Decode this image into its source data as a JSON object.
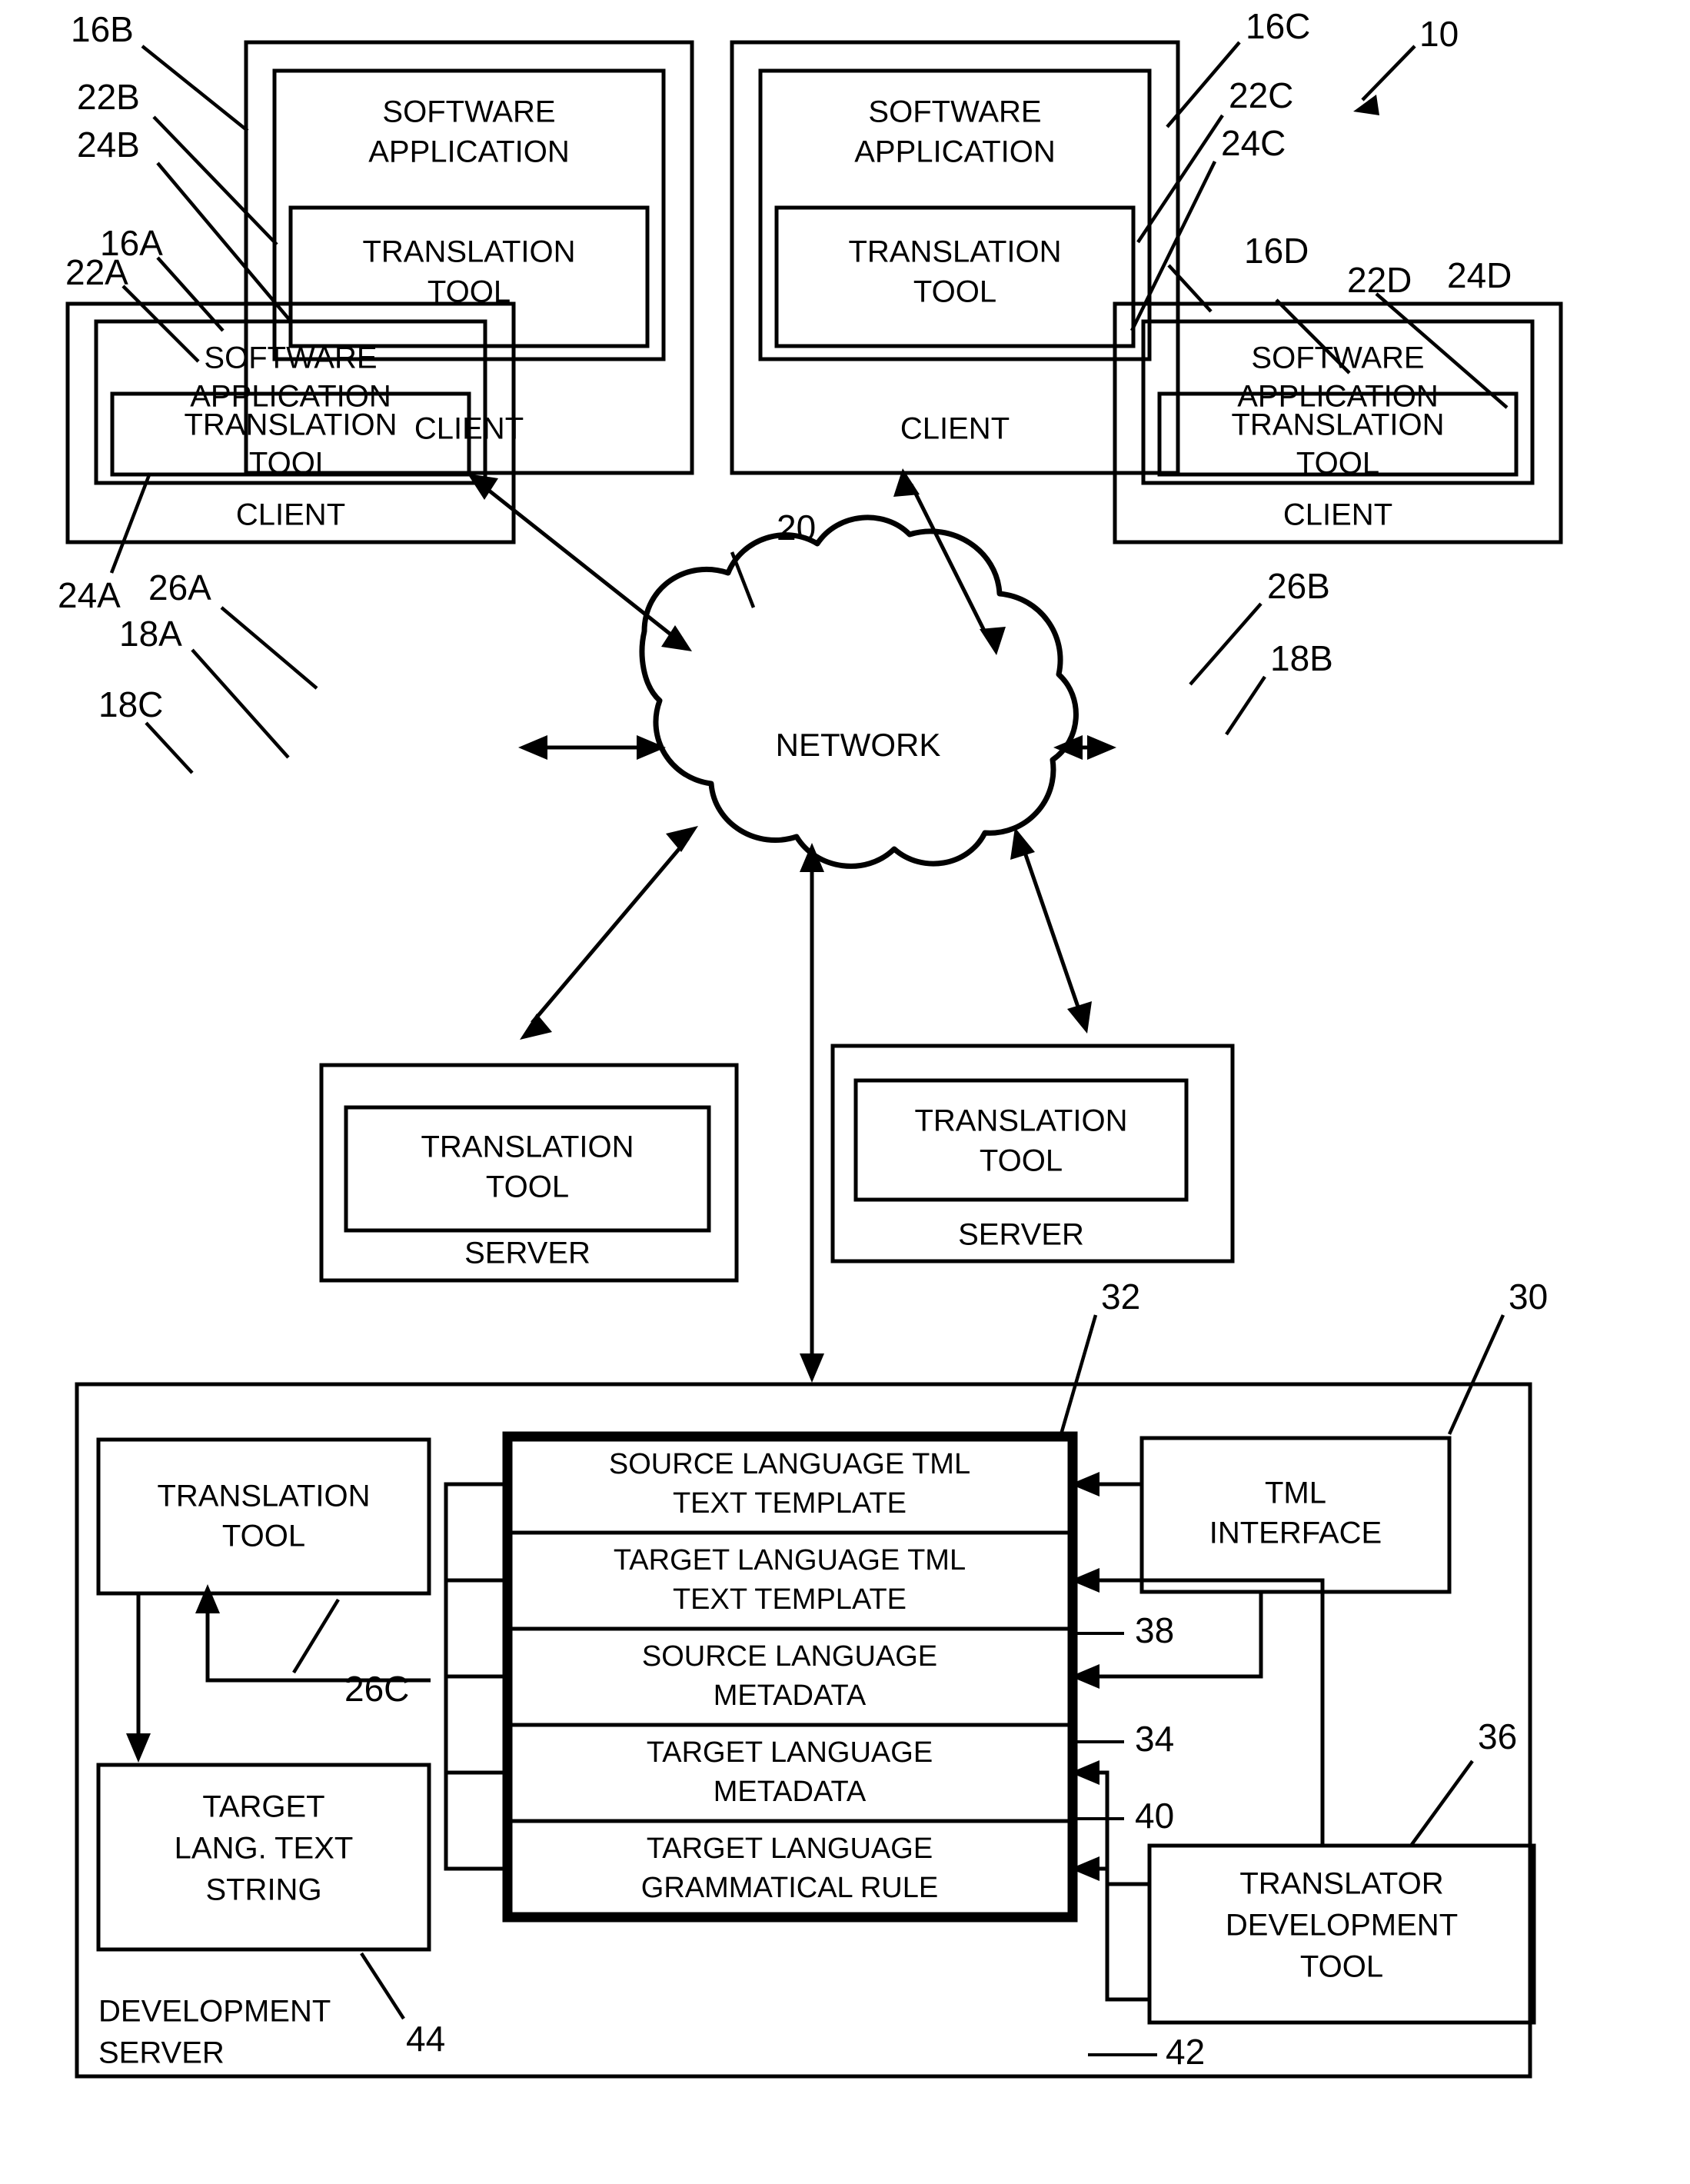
{
  "figure": {
    "system_ref": "10",
    "network_label": "NETWORK",
    "network_ref": "20"
  },
  "clients": [
    {
      "id": "client-a",
      "client_label": "CLIENT",
      "app_label_line1": "SOFTWARE",
      "app_label_line2": "APPLICATION",
      "tool_label_line1": "TRANSLATION",
      "tool_label_line2": "TOOL",
      "ref_client": "16A",
      "ref_app": "22A",
      "ref_tool": "24A"
    },
    {
      "id": "client-b",
      "client_label": "CLIENT",
      "app_label_line1": "SOFTWARE",
      "app_label_line2": "APPLICATION",
      "tool_label_line1": "TRANSLATION",
      "tool_label_line2": "TOOL",
      "ref_client": "16B",
      "ref_app": "22B",
      "ref_tool": "24B"
    },
    {
      "id": "client-c",
      "client_label": "CLIENT",
      "app_label_line1": "SOFTWARE",
      "app_label_line2": "APPLICATION",
      "tool_label_line1": "TRANSLATION",
      "tool_label_line2": "TOOL",
      "ref_client": "16C",
      "ref_app": "22C",
      "ref_tool": "24C"
    },
    {
      "id": "client-d",
      "client_label": "CLIENT",
      "app_label_line1": "SOFTWARE",
      "app_label_line2": "APPLICATION",
      "tool_label_line1": "TRANSLATION",
      "tool_label_line2": "TOOL",
      "ref_client": "16D",
      "ref_app": "22D",
      "ref_tool": "24D"
    }
  ],
  "servers": [
    {
      "id": "server-a",
      "server_label": "SERVER",
      "tool_label_line1": "TRANSLATION",
      "tool_label_line2": "TOOL",
      "ref_server": "18A",
      "ref_tool": "26A"
    },
    {
      "id": "server-b",
      "server_label": "SERVER",
      "tool_label_line1": "TRANSLATION",
      "tool_label_line2": "TOOL",
      "ref_server": "18B",
      "ref_tool": "26B"
    }
  ],
  "development_server": {
    "label_line1": "DEVELOPMENT",
    "label_line2": "SERVER",
    "ref_server": "18C",
    "ref_outer": "30",
    "translation_tool": {
      "line1": "TRANSLATION",
      "line2": "TOOL",
      "ref": "26C"
    },
    "target_text_string": {
      "line1": "TARGET",
      "line2": "LANG. TEXT",
      "line3": "STRING",
      "ref": "44"
    },
    "tml_interface": {
      "line1": "TML",
      "line2": "INTERFACE"
    },
    "translator_development_tool": {
      "line1": "TRANSLATOR",
      "line2": "DEVELOPMENT",
      "line3": "TOOL",
      "ref": "36"
    },
    "tml_stack_ref": "32",
    "tml_stack": [
      {
        "line1": "SOURCE LANGUAGE TML",
        "line2": "TEXT TEMPLATE",
        "ref": ""
      },
      {
        "line1": "TARGET LANGUAGE TML",
        "line2": "TEXT TEMPLATE",
        "ref": "38"
      },
      {
        "line1": "SOURCE LANGUAGE",
        "line2": "METADATA",
        "ref": "34"
      },
      {
        "line1": "TARGET LANGUAGE",
        "line2": "METADATA",
        "ref": "40"
      },
      {
        "line1": "TARGET LANGUAGE",
        "line2": "GRAMMATICAL RULE",
        "ref": "42"
      }
    ]
  }
}
